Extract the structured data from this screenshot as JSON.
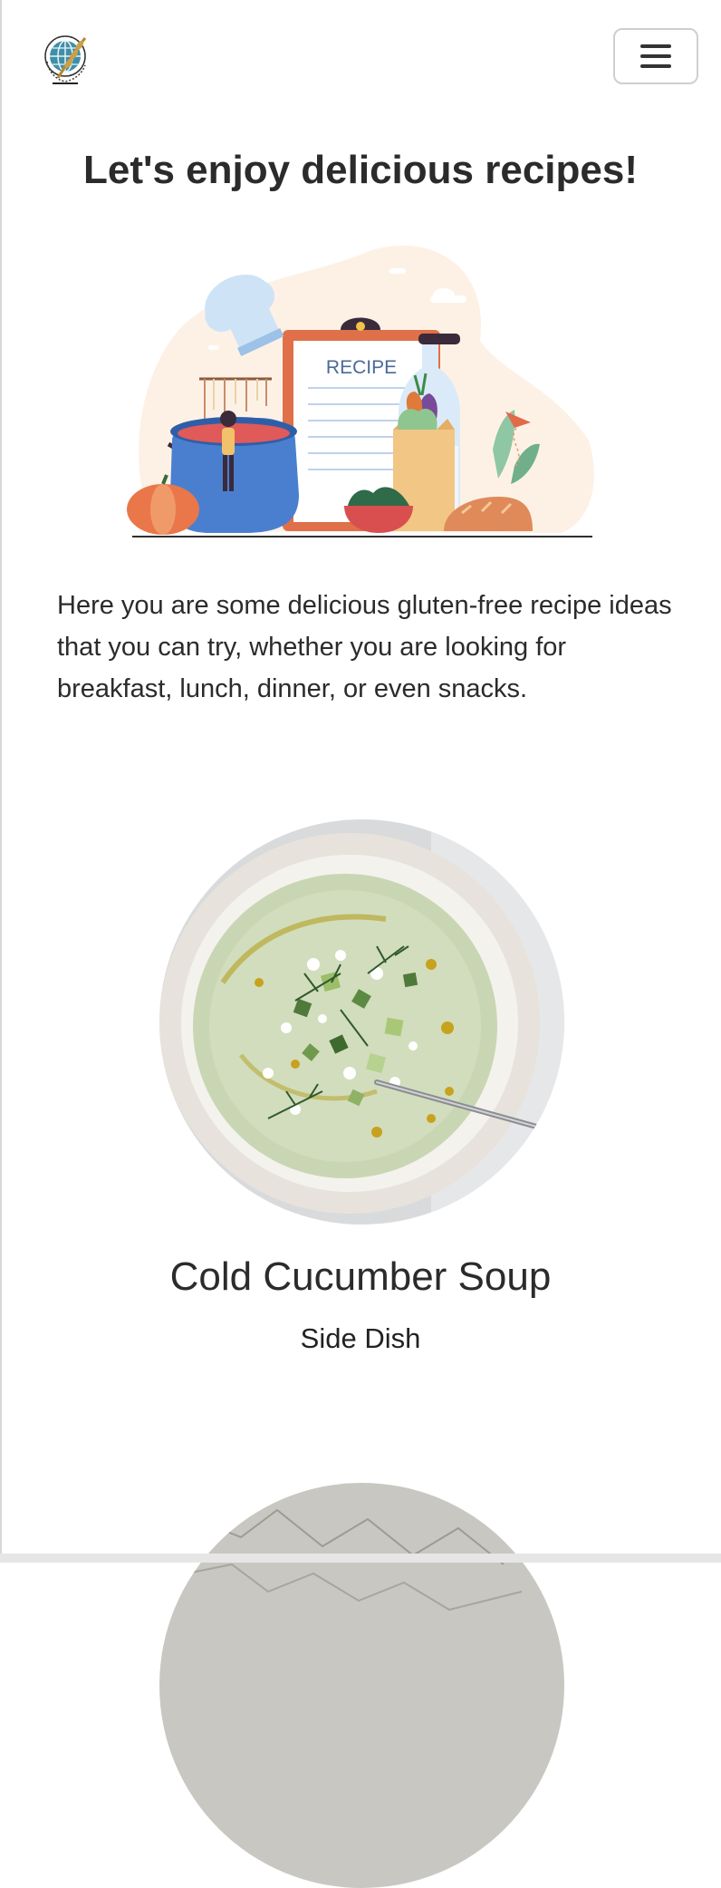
{
  "header": {
    "logo_icon": "globe-wheat-logo-icon",
    "menu_icon": "hamburger-menu-icon"
  },
  "main": {
    "headline": "Let's enjoy delicious recipes!",
    "hero": {
      "clipboard_label": "RECIPE"
    },
    "intro": "Here you are some delicious gluten-free recipe ideas that you can try, whether you are looking for breakfast, lunch, dinner, or even snacks."
  },
  "recipes": [
    {
      "title": "Cold Cucumber Soup",
      "category": "Side Dish"
    }
  ],
  "colors": {
    "text": "#2b2b2b",
    "accent_orange": "#e0704a",
    "accent_blue": "#4a7fd0"
  }
}
